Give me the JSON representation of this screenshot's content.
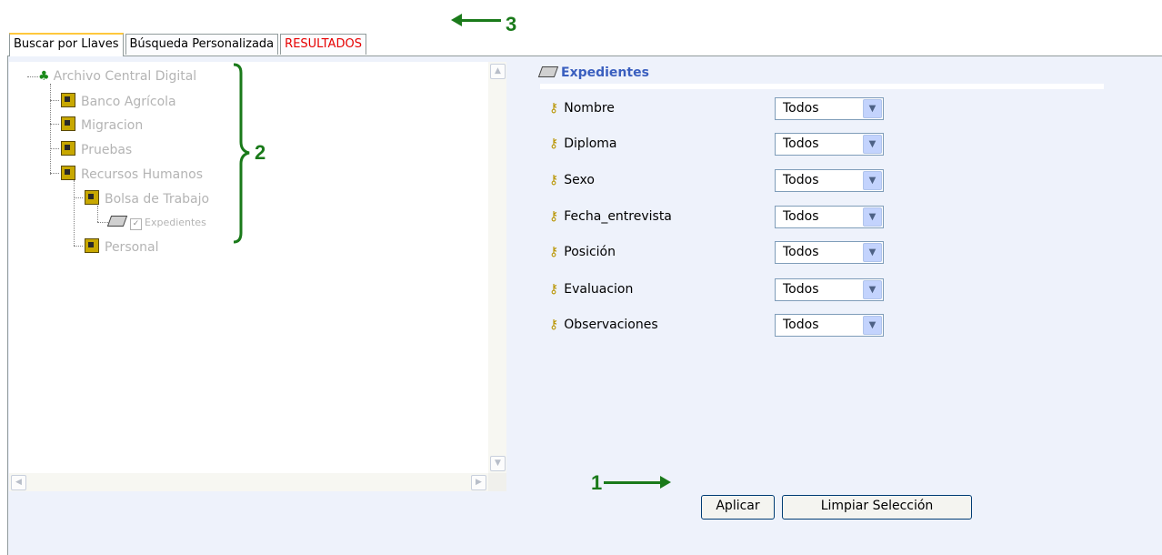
{
  "tabs": [
    {
      "label": "Buscar por Llaves"
    },
    {
      "label": "Búsqueda Personalizada"
    },
    {
      "label": "RESULTADOS"
    }
  ],
  "tree": {
    "root": "Archivo Central Digital",
    "items": [
      "Banco Agrícola",
      "Migracion",
      "Pruebas",
      "Recursos Humanos",
      "Bolsa de Trabajo",
      "Expedientes",
      "Personal"
    ]
  },
  "main": {
    "section_title": "Expedientes",
    "fields": [
      {
        "label": "Nombre",
        "value": "Todos"
      },
      {
        "label": "Diploma",
        "value": "Todos"
      },
      {
        "label": "Sexo",
        "value": "Todos"
      },
      {
        "label": "Fecha_entrevista",
        "value": "Todos"
      },
      {
        "label": "Posición",
        "value": "Todos"
      },
      {
        "label": "Evaluacion",
        "value": "Todos"
      },
      {
        "label": "Observaciones",
        "value": "Todos"
      }
    ],
    "apply_label": "Aplicar",
    "clear_label": "Limpiar Selección"
  },
  "annotations": {
    "a1": "1",
    "a2": "2",
    "a3": "3"
  },
  "colors": {
    "annotation": "#1a7a1a",
    "results_tab": "#e60000",
    "panel_bg": "#eef2fb"
  }
}
